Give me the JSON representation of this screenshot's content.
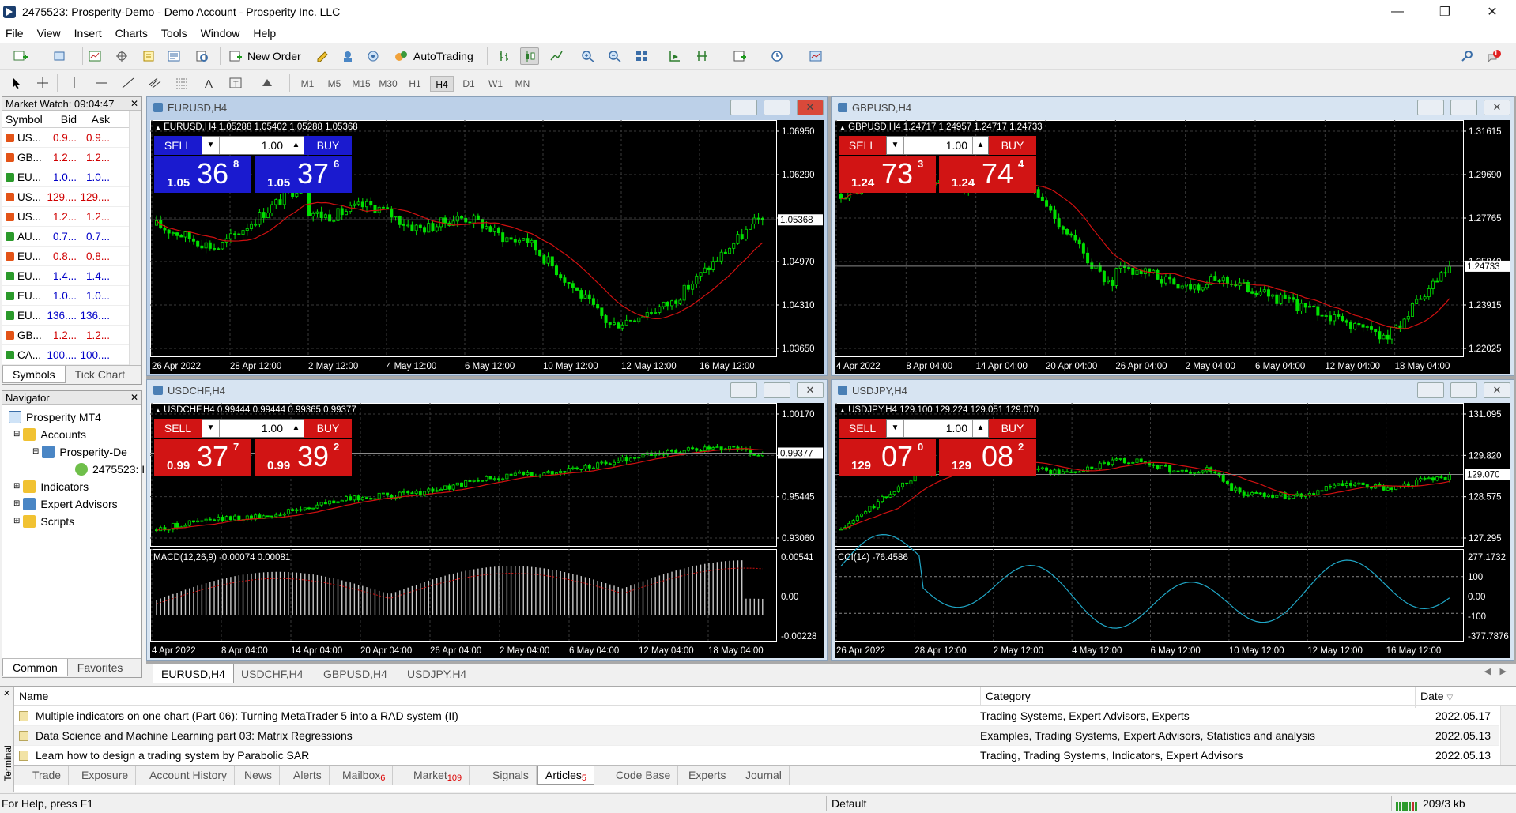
{
  "window": {
    "title": "2475523: Prosperity-Demo - Demo Account - Prosperity Inc. LLC"
  },
  "menu": [
    "File",
    "View",
    "Insert",
    "Charts",
    "Tools",
    "Window",
    "Help"
  ],
  "toolbar": {
    "new_order": "New Order",
    "autotrading": "AutoTrading",
    "notification_count": "1"
  },
  "timeframes": [
    {
      "label": "M1",
      "active": false
    },
    {
      "label": "M5",
      "active": false
    },
    {
      "label": "M15",
      "active": false
    },
    {
      "label": "M30",
      "active": false
    },
    {
      "label": "H1",
      "active": false
    },
    {
      "label": "H4",
      "active": true
    },
    {
      "label": "D1",
      "active": false
    },
    {
      "label": "W1",
      "active": false
    },
    {
      "label": "MN",
      "active": false
    }
  ],
  "market_watch": {
    "title": "Market Watch: 09:04:47",
    "columns": [
      "Symbol",
      "Bid",
      "Ask"
    ],
    "rows": [
      {
        "symbol": "US...",
        "bid": "0.9...",
        "ask": "0.9...",
        "dir": "down"
      },
      {
        "symbol": "GB...",
        "bid": "1.2...",
        "ask": "1.2...",
        "dir": "down"
      },
      {
        "symbol": "EU...",
        "bid": "1.0...",
        "ask": "1.0...",
        "dir": "up"
      },
      {
        "symbol": "US...",
        "bid": "129....",
        "ask": "129....",
        "dir": "down"
      },
      {
        "symbol": "US...",
        "bid": "1.2...",
        "ask": "1.2...",
        "dir": "down"
      },
      {
        "symbol": "AU...",
        "bid": "0.7...",
        "ask": "0.7...",
        "dir": "up"
      },
      {
        "symbol": "EU...",
        "bid": "0.8...",
        "ask": "0.8...",
        "dir": "down"
      },
      {
        "symbol": "EU...",
        "bid": "1.4...",
        "ask": "1.4...",
        "dir": "up"
      },
      {
        "symbol": "EU...",
        "bid": "1.0...",
        "ask": "1.0...",
        "dir": "up"
      },
      {
        "symbol": "EU...",
        "bid": "136....",
        "ask": "136....",
        "dir": "up"
      },
      {
        "symbol": "GB...",
        "bid": "1.2...",
        "ask": "1.2...",
        "dir": "down"
      },
      {
        "symbol": "CA...",
        "bid": "100....",
        "ask": "100....",
        "dir": "up"
      }
    ],
    "tabs": [
      "Symbols",
      "Tick Chart"
    ]
  },
  "navigator": {
    "title": "Navigator",
    "items": [
      "Prosperity MT4",
      "Accounts",
      "Prosperity-De",
      "2475523: I",
      "Indicators",
      "Expert Advisors",
      "Scripts"
    ],
    "tabs": [
      "Common",
      "Favorites"
    ]
  },
  "charts": [
    {
      "id": "eurusd",
      "title": "EURUSD,H4",
      "info": "EURUSD,H4  1.05288 1.05402 1.05288 1.05368",
      "sell_color": "#1a1acf",
      "buy_color": "#1a1acf",
      "trade": {
        "sell": "SELL",
        "buy": "BUY",
        "lot": "1.00",
        "sell_prefix": "1.05",
        "sell_big": "36",
        "sell_sup": "8",
        "buy_prefix": "1.05",
        "buy_big": "37",
        "buy_sup": "6"
      },
      "price_ticks": [
        "1.06950",
        "1.06290",
        "1.05630",
        "1.04970",
        "1.04310",
        "1.03650"
      ],
      "current_price": "1.05368",
      "date_ticks": [
        "26 Apr 2022",
        "28 Apr 12:00",
        "2 May 12:00",
        "4 May 12:00",
        "6 May 12:00",
        "10 May 12:00",
        "12 May 12:00",
        "16 May 12:00"
      ]
    },
    {
      "id": "gbpusd",
      "title": "GBPUSD,H4",
      "info": "GBPUSD,H4  1.24717 1.24957 1.24717 1.24733",
      "sell_color": "#d11414",
      "buy_color": "#d11414",
      "trade": {
        "sell": "SELL",
        "buy": "BUY",
        "lot": "1.00",
        "sell_prefix": "1.24",
        "sell_big": "73",
        "sell_sup": "3",
        "buy_prefix": "1.24",
        "buy_big": "74",
        "buy_sup": "4"
      },
      "price_ticks": [
        "1.31615",
        "1.29690",
        "1.27765",
        "1.25840",
        "1.23915",
        "1.22025"
      ],
      "current_price": "1.24733",
      "date_ticks": [
        "4 Apr 2022",
        "8 Apr 04:00",
        "14 Apr 04:00",
        "20 Apr 04:00",
        "26 Apr 04:00",
        "2 May 04:00",
        "6 May 04:00",
        "12 May 04:00",
        "18 May 04:00"
      ]
    },
    {
      "id": "usdchf",
      "title": "USDCHF,H4",
      "info": "USDCHF,H4  0.99444 0.99444 0.99365 0.99377",
      "sell_color": "#d11414",
      "buy_color": "#d11414",
      "trade": {
        "sell": "SELL",
        "buy": "BUY",
        "lot": "1.00",
        "sell_prefix": "0.99",
        "sell_big": "37",
        "sell_sup": "7",
        "buy_prefix": "0.99",
        "buy_big": "39",
        "buy_sup": "2"
      },
      "price_ticks": [
        "1.00170",
        "0.97785",
        "0.95445",
        "0.93060"
      ],
      "current_price": "0.99377",
      "indicator": "MACD(12,26,9) -0.00074 0.00081",
      "ind_ticks": [
        "0.00541",
        "0.00",
        "-0.00228"
      ],
      "date_ticks": [
        "4 Apr 2022",
        "8 Apr 04:00",
        "14 Apr 04:00",
        "20 Apr 04:00",
        "26 Apr 04:00",
        "2 May 04:00",
        "6 May 04:00",
        "12 May 04:00",
        "18 May 04:00"
      ]
    },
    {
      "id": "usdjpy",
      "title": "USDJPY,H4",
      "info": "USDJPY,H4  129.100 129.224 129.051 129.070",
      "sell_color": "#d11414",
      "buy_color": "#d11414",
      "trade": {
        "sell": "SELL",
        "buy": "BUY",
        "lot": "1.00",
        "sell_prefix": "129",
        "sell_big": "07",
        "sell_sup": "0",
        "buy_prefix": "129",
        "buy_big": "08",
        "buy_sup": "2"
      },
      "price_ticks": [
        "131.095",
        "129.820",
        "128.575",
        "127.295"
      ],
      "current_price": "129.070",
      "indicator": "CCI(14) -76.4586",
      "ind_ticks": [
        "277.1732",
        "100",
        "0.00",
        "-100",
        "-377.7876"
      ],
      "date_ticks": [
        "26 Apr 2022",
        "28 Apr 12:00",
        "2 May 12:00",
        "4 May 12:00",
        "6 May 12:00",
        "10 May 12:00",
        "12 May 12:00",
        "16 May 12:00"
      ]
    }
  ],
  "chart_tabs": [
    "EURUSD,H4",
    "USDCHF,H4",
    "GBPUSD,H4",
    "USDJPY,H4"
  ],
  "terminal": {
    "side_label": "Terminal",
    "columns": [
      "Name",
      "Category",
      "Date"
    ],
    "rows": [
      {
        "name": "Multiple indicators on one chart (Part 06): Turning MetaTrader 5 into a RAD system (II)",
        "category": "Trading Systems, Expert Advisors, Experts",
        "date": "2022.05.17"
      },
      {
        "name": "Data Science and Machine Learning part 03: Matrix Regressions",
        "category": "Examples, Trading Systems, Expert Advisors, Statistics and analysis",
        "date": "2022.05.13"
      },
      {
        "name": "Learn how to design a trading system by Parabolic SAR",
        "category": "Trading, Trading Systems, Indicators, Expert Advisors",
        "date": "2022.05.13"
      }
    ],
    "tabs": [
      {
        "label": "Trade",
        "badge": ""
      },
      {
        "label": "Exposure",
        "badge": ""
      },
      {
        "label": "Account History",
        "badge": ""
      },
      {
        "label": "News",
        "badge": ""
      },
      {
        "label": "Alerts",
        "badge": ""
      },
      {
        "label": "Mailbox",
        "badge": "6"
      },
      {
        "label": "Market",
        "badge": "109"
      },
      {
        "label": "Signals",
        "badge": ""
      },
      {
        "label": "Articles",
        "badge": "5"
      },
      {
        "label": "Code Base",
        "badge": ""
      },
      {
        "label": "Experts",
        "badge": ""
      },
      {
        "label": "Journal",
        "badge": ""
      }
    ]
  },
  "status": {
    "help": "For Help, press F1",
    "profile": "Default",
    "traffic": "209/3 kb"
  }
}
